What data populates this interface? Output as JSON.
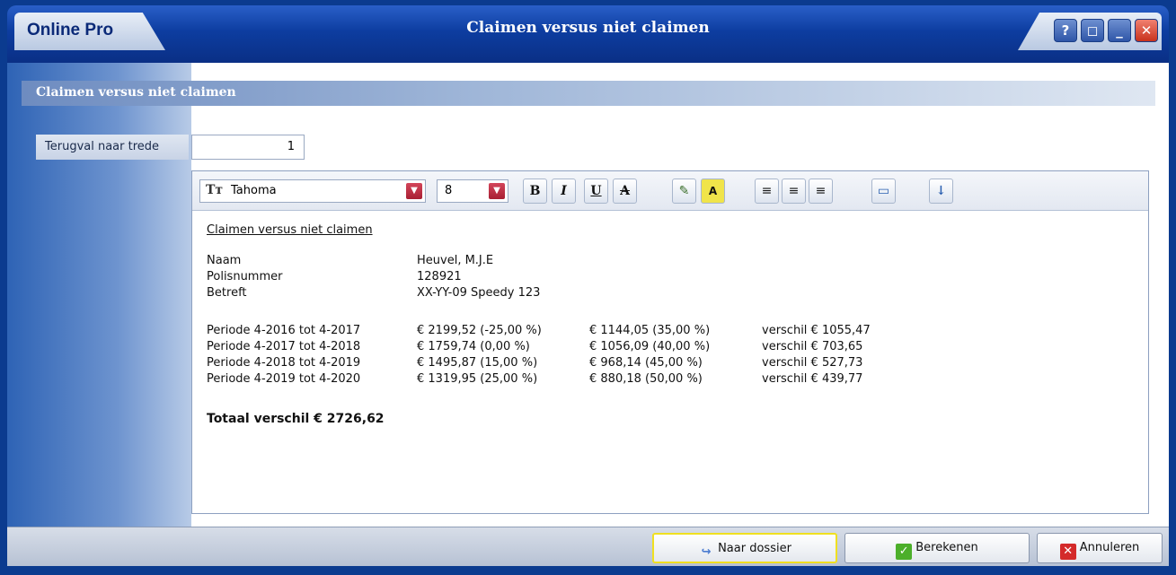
{
  "window": {
    "brand": "Online Pro",
    "title": "Claimen versus niet claimen",
    "buttons": [
      "help",
      "restore",
      "minimize",
      "close"
    ]
  },
  "section": {
    "header": "Claimen versus niet claimen"
  },
  "form": {
    "trede_label": "Terugval naar trede",
    "trede_value": "1"
  },
  "toolbar": {
    "font_name": "Tahoma",
    "font_size": "8",
    "bold": "B",
    "italic": "I",
    "underline": "U",
    "strike": "A",
    "highlight": "A"
  },
  "document": {
    "title": "Claimen versus niet claimen",
    "info": [
      {
        "label": "Naam",
        "value": "Heuvel, M.J.E"
      },
      {
        "label": "Polisnummer",
        "value": "128921"
      },
      {
        "label": "Betreft",
        "value": "XX-YY-09 Speedy 123"
      }
    ],
    "periods": [
      {
        "period": "Periode 4-2016 tot 4-2017",
        "claim": "€ 2199,52 (-25,00 %)",
        "noclaim": "€ 1144,05 (35,00 %)",
        "diff": "verschil € 1055,47"
      },
      {
        "period": "Periode 4-2017 tot 4-2018",
        "claim": "€ 1759,74 (0,00 %)",
        "noclaim": "€ 1056,09 (40,00 %)",
        "diff": "verschil € 703,65"
      },
      {
        "period": "Periode 4-2018 tot 4-2019",
        "claim": "€ 1495,87 (15,00 %)",
        "noclaim": "€ 968,14 (45,00 %)",
        "diff": "verschil € 527,73"
      },
      {
        "period": "Periode 4-2019 tot 4-2020",
        "claim": "€ 1319,95 (25,00 %)",
        "noclaim": "€ 880,18 (50,00 %)",
        "diff": "verschil € 439,77"
      }
    ],
    "total": "Totaal verschil € 2726,62"
  },
  "footer": {
    "naar_dossier": "Naar dossier",
    "berekenen": "Berekenen",
    "annuleren": "Annuleren"
  }
}
